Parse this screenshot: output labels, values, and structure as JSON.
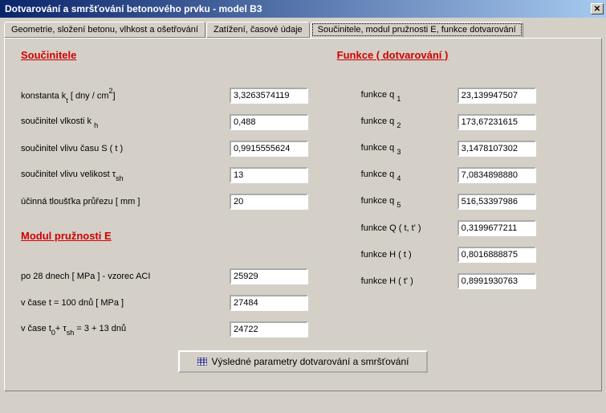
{
  "title": "Dotvarování a smršťování betonového prvku - model B3",
  "tabs": {
    "t1": "Geometrie, složení betonu, vlhkost a ošetřování",
    "t2": "Zatížení, časové údaje",
    "t3": "Součinitele, modul pružnosti E, funkce dotvarování"
  },
  "headings": {
    "soucinitele": "Součinitele",
    "modul": "Modul pružnosti E",
    "funkce": "Funkce ( dotvarování )"
  },
  "left": {
    "k_t_label_a": "konstanta k",
    "k_t_label_b": " [ dny / cm",
    "k_t_label_c": "]",
    "k_t": "3,3263574119",
    "k_h_label_a": "součinitel vlkosti k",
    "k_h": "0,488",
    "s_t_label": "součinitel vlivu času S ( t )",
    "s_t": "0,9915555624",
    "tau_label_a": "součinitel vlivu velikost ",
    "tau": "13",
    "thk_label": "účinná tloušťka průřezu [ mm ]",
    "thk": "20",
    "e28_label": "po 28 dnech [ MPa ] - vzorec ACI",
    "e28": "25929",
    "e100_label": "v čase t = 100 dnů [ MPa ]",
    "e100": "27484",
    "et0_label_a": "v čase t",
    "et0_label_b": "+ ",
    "et0_label_c": " = 3 + 13 dnů",
    "et0": "24722"
  },
  "right": {
    "q1_label": "funkce q",
    "q1": "23,139947507",
    "q2": "173,67231615",
    "q3": "3,1478107302",
    "q4": "7,0834898880",
    "q5": "516,53397986",
    "Q_label": "funkce Q ( t, t' )",
    "Q": "0,3199677211",
    "Ht_label": "funkce H ( t )",
    "Ht": "0,8016888875",
    "Htp_label": "funkce H ( t' )",
    "Htp": "0,8991930763"
  },
  "button": "Výsledné parametry dotvarování a smršťování"
}
